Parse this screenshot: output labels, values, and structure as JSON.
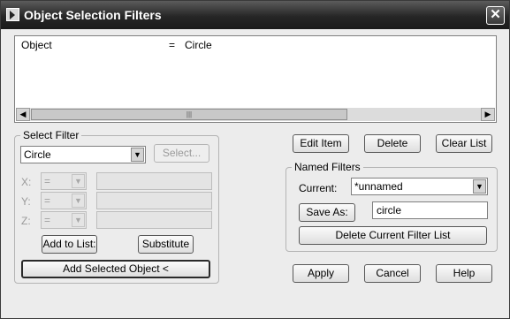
{
  "window": {
    "title": "Object Selection Filters",
    "close_label": "✕"
  },
  "filter_list": {
    "rows": [
      {
        "property": "Object",
        "operator": "=",
        "value": "Circle"
      }
    ],
    "scroll_left": "◀",
    "scroll_right": "▶",
    "scroll_thumb_grip": "|||"
  },
  "select_filter": {
    "group_label": "Select Filter",
    "type_value": "Circle",
    "select_button": "Select...",
    "x_label": "X:",
    "y_label": "Y:",
    "z_label": "Z:",
    "operator_placeholder": "=",
    "add_to_list_button": "Add to List:",
    "substitute_button": "Substitute",
    "add_selected_button": "Add Selected Object <"
  },
  "actions": {
    "edit_item": "Edit Item",
    "delete": "Delete",
    "clear_list": "Clear List"
  },
  "named_filters": {
    "group_label": "Named Filters",
    "current_label": "Current:",
    "current_value": "*unnamed",
    "save_as_button": "Save As:",
    "save_as_value": "circle",
    "delete_filter_button": "Delete Current Filter List"
  },
  "footer": {
    "apply": "Apply",
    "cancel": "Cancel",
    "help": "Help"
  },
  "icons": {
    "dropdown_arrow": "▼"
  }
}
